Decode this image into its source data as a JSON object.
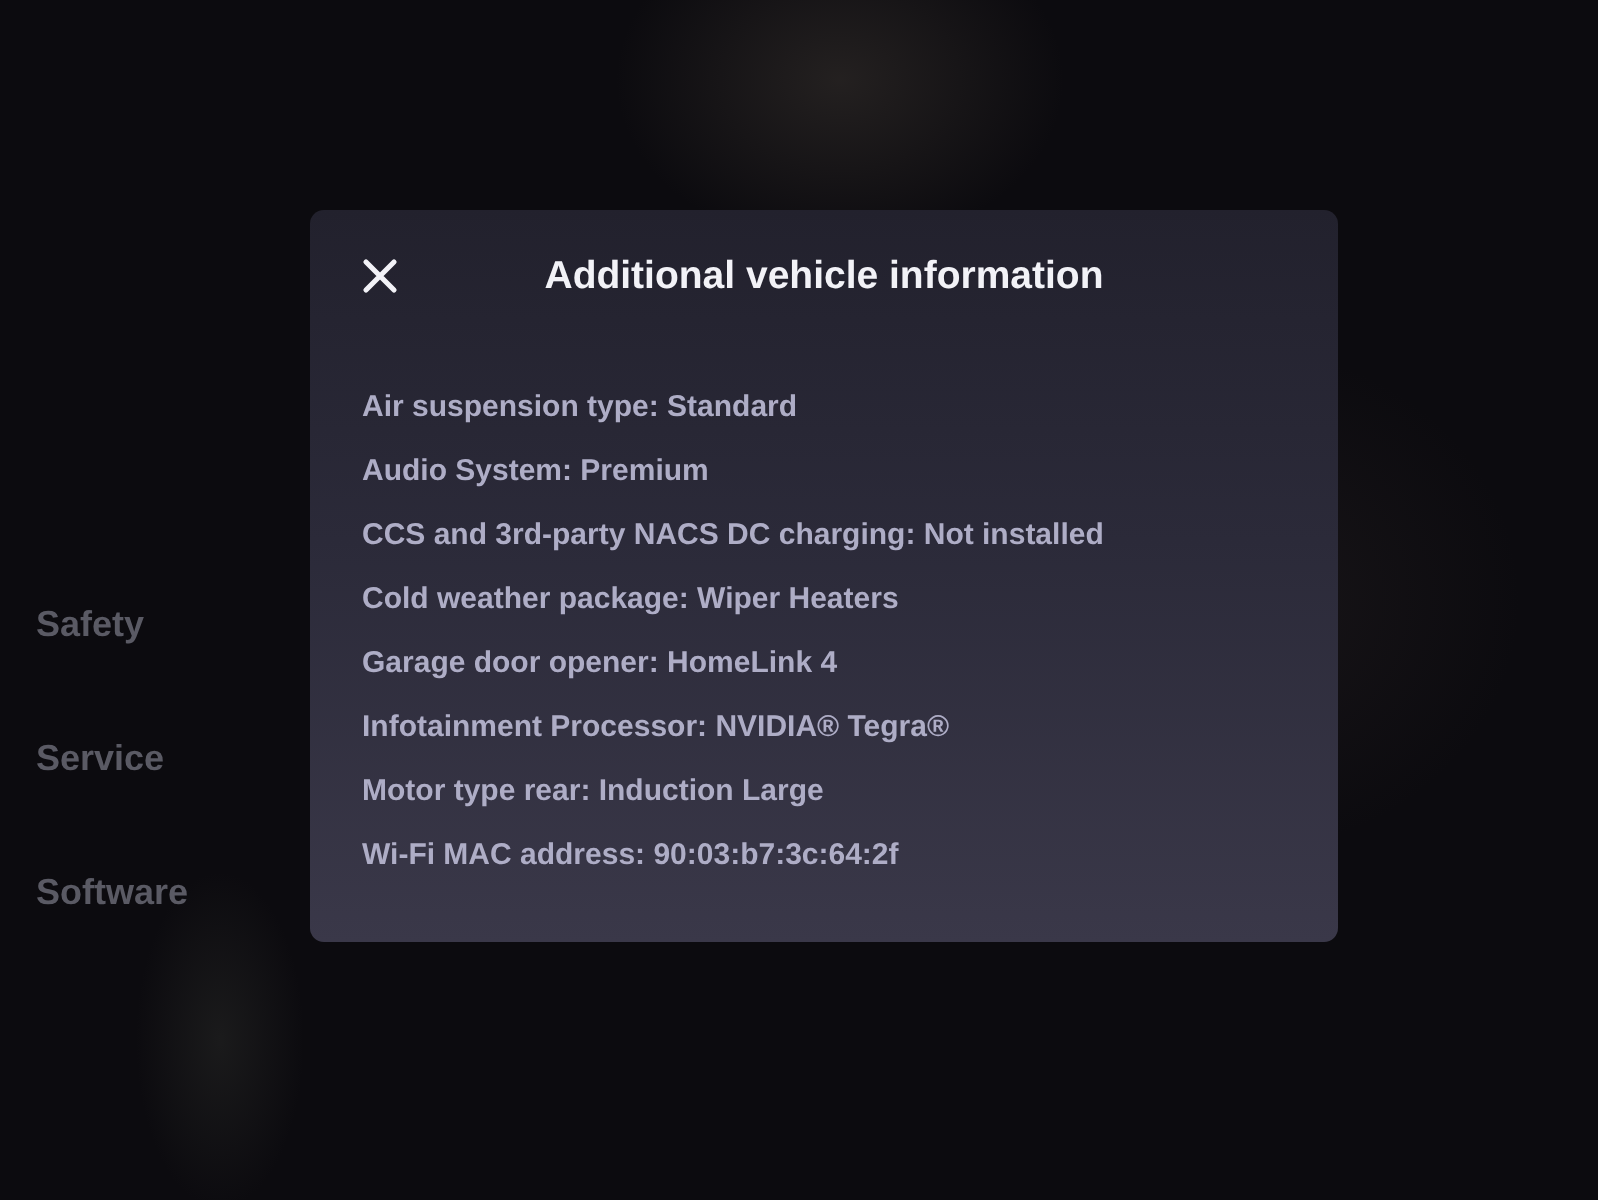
{
  "sidebar": {
    "items": [
      {
        "label": "Safety"
      },
      {
        "label": "Service"
      },
      {
        "label": "Software"
      }
    ]
  },
  "dialog": {
    "title": "Additional vehicle information",
    "lines": [
      "Air suspension type: Standard",
      "Audio System: Premium",
      "CCS and 3rd-party NACS DC charging: Not installed",
      "Cold weather package: Wiper Heaters",
      "Garage door opener: HomeLink 4",
      "Infotainment Processor: NVIDIA® Tegra®",
      "Motor type rear: Induction Large",
      "Wi-Fi MAC address: 90:03:b7:3c:64:2f"
    ]
  }
}
